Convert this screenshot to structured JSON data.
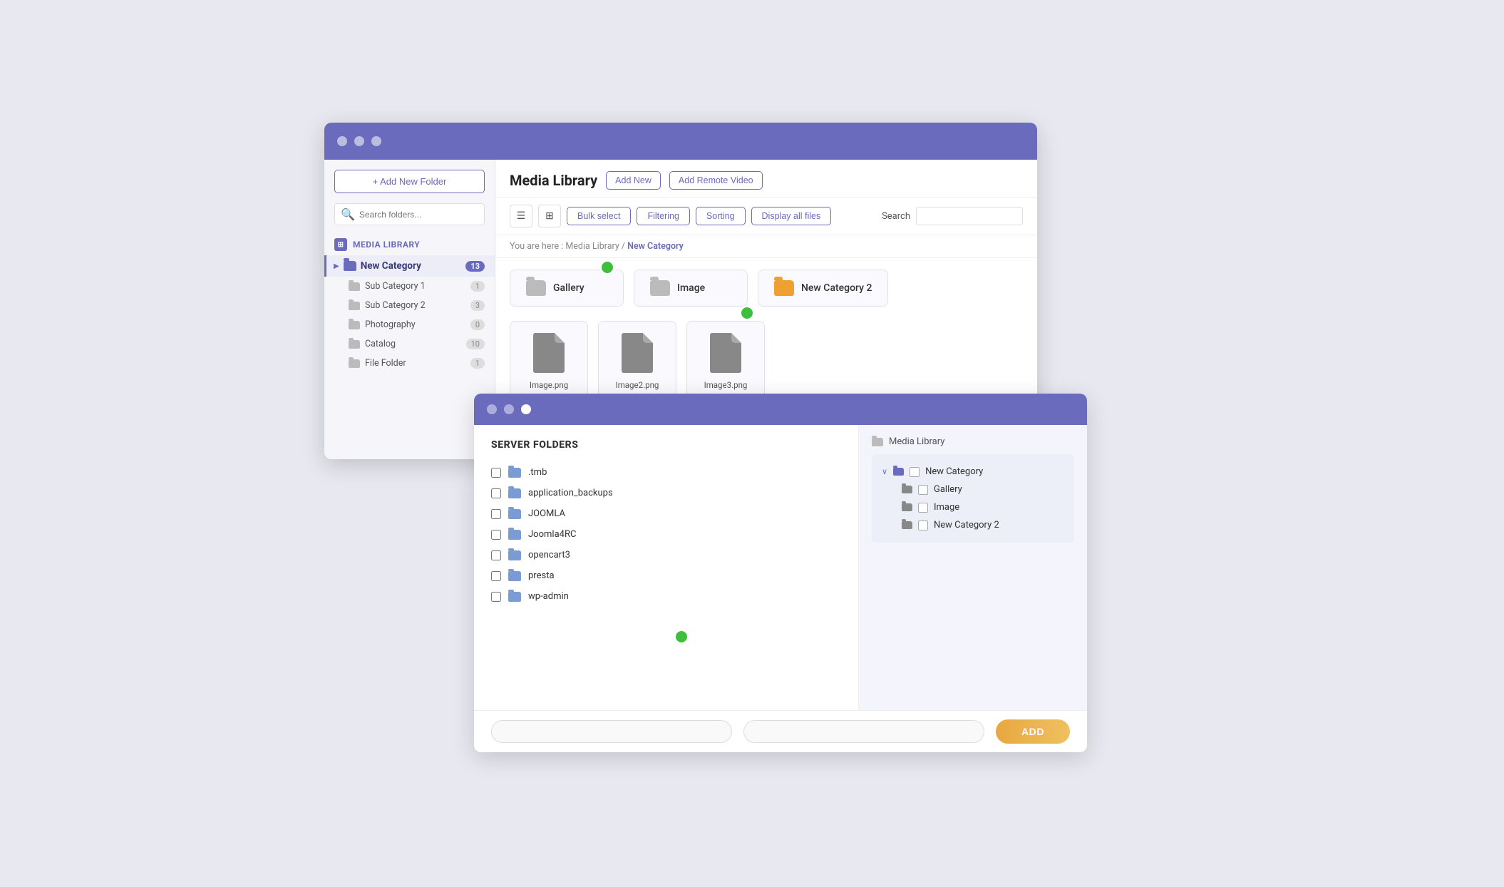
{
  "window1": {
    "titlebar": {
      "dots": [
        "dot1",
        "dot2",
        "dot3"
      ]
    },
    "sidebar": {
      "add_folder_label": "+ Add New Folder",
      "search_placeholder": "Search folders...",
      "media_library_label": "MEDIA LIBRARY",
      "new_category": {
        "name": "New Category",
        "badge": "13",
        "chevron": "▶"
      },
      "sub_items": [
        {
          "name": "Sub Category 1",
          "badge": "1"
        },
        {
          "name": "Sub Category 2",
          "badge": "3"
        },
        {
          "name": "Photography",
          "badge": "0"
        },
        {
          "name": "Catalog",
          "badge": "10"
        },
        {
          "name": "File Folder",
          "badge": "1"
        }
      ]
    },
    "header": {
      "title": "Media Library",
      "btn_add_new": "Add New",
      "btn_add_remote": "Add Remote Video"
    },
    "toolbar": {
      "btn_bulk_select": "Bulk select",
      "btn_filtering": "Filtering",
      "btn_sorting": "Sorting",
      "btn_display_all": "Display all files",
      "search_label": "Search"
    },
    "breadcrumb": {
      "prefix": "You are here :",
      "root": "Media Library",
      "separator": "/",
      "current": "New Category"
    },
    "folders": [
      {
        "name": "Gallery",
        "color": "gray"
      },
      {
        "name": "Image",
        "color": "gray"
      },
      {
        "name": "New Category 2",
        "color": "orange"
      }
    ],
    "files": [
      {
        "name": "Image.png"
      },
      {
        "name": "Image2.png"
      },
      {
        "name": "Image3.png"
      }
    ]
  },
  "window2": {
    "titlebar": {
      "dots": [
        "active",
        "inactive",
        "active"
      ]
    },
    "server_folders": {
      "title": "SERVER FOLDERS",
      "items": [
        {
          "name": ".tmb"
        },
        {
          "name": "application_backups"
        },
        {
          "name": "JOOMLA"
        },
        {
          "name": "Joomla4RC"
        },
        {
          "name": "opencart3"
        },
        {
          "name": "presta"
        },
        {
          "name": "wp-admin"
        }
      ]
    },
    "right_panel": {
      "header": "Media Library",
      "tree": {
        "root": "New Category",
        "chevron": "∨",
        "children": [
          {
            "name": "Gallery"
          },
          {
            "name": "Image"
          },
          {
            "name": "New Category 2"
          }
        ]
      }
    },
    "bottom": {
      "input1_placeholder": "",
      "input2_placeholder": "",
      "add_label": "ADD"
    }
  }
}
